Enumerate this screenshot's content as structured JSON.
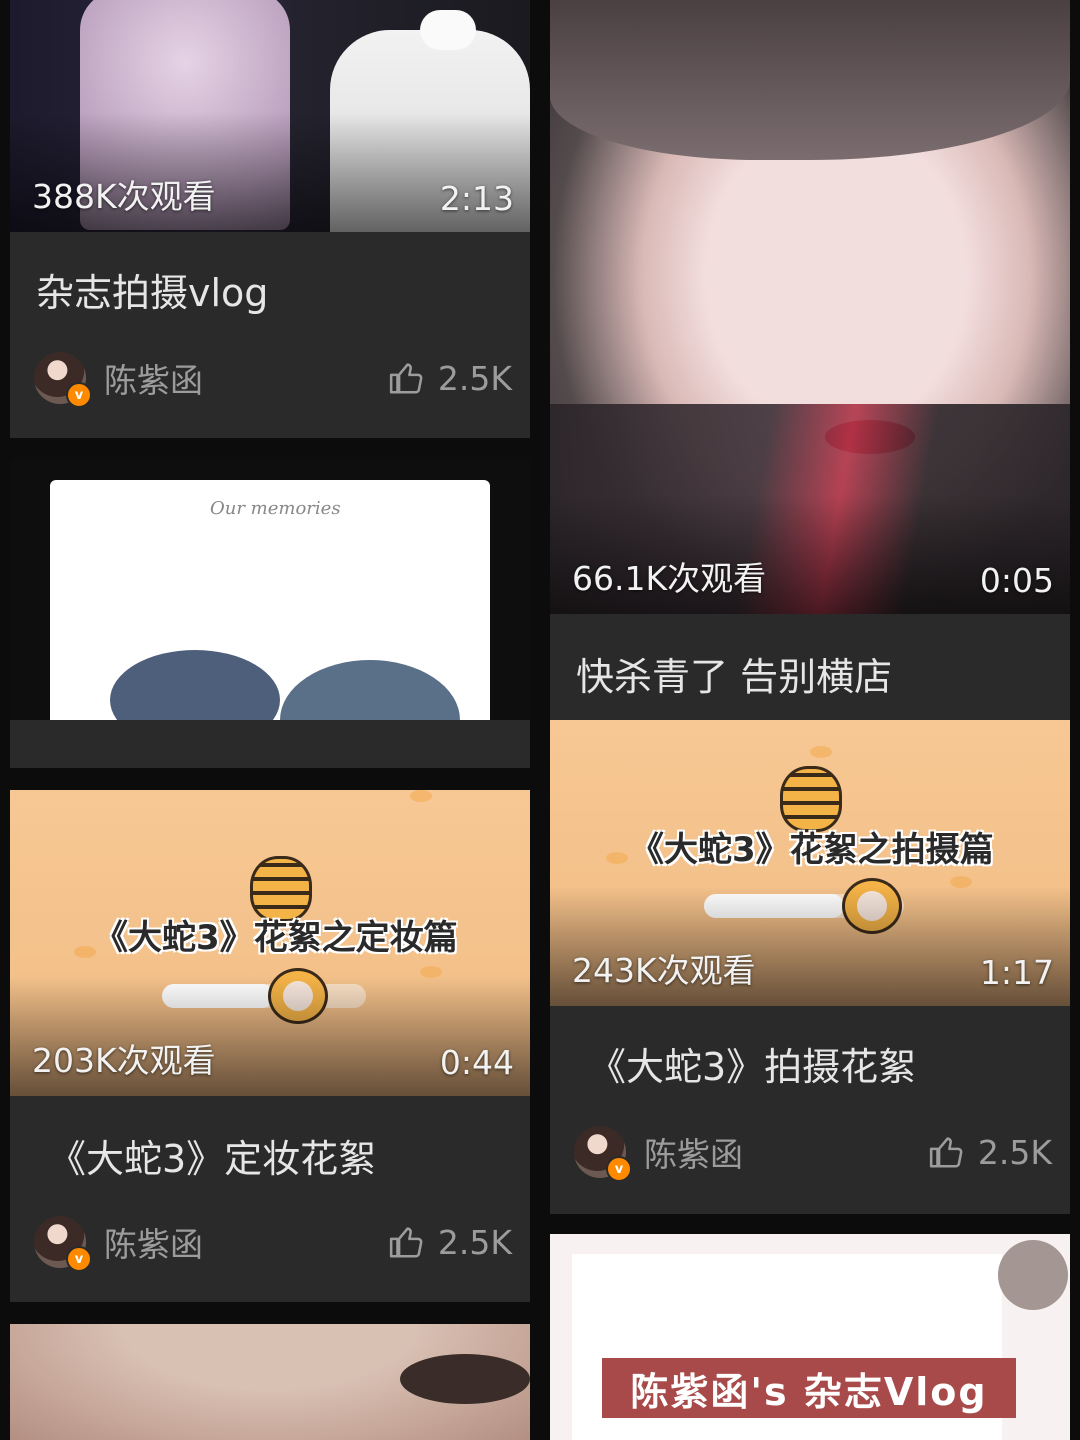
{
  "cards": [
    {
      "id": "c1",
      "views": "388K次观看",
      "duration": "2:13",
      "title": "杂志拍摄vlog",
      "author": "陈紫函",
      "likes": "2.5K"
    },
    {
      "id": "c2",
      "views": "",
      "duration": "",
      "title": "",
      "author": "",
      "likes": "",
      "thumb_text": "Our memories"
    },
    {
      "id": "c3",
      "views": "203K次观看",
      "duration": "0:44",
      "title": "《大蛇3》定妆花絮",
      "author": "陈紫函",
      "likes": "2.5K",
      "thumb_text": "《大蛇3》花絮之定妆篇"
    },
    {
      "id": "c5",
      "views": "66.1K次观看",
      "duration": "0:05",
      "title": "快杀青了 告别横店"
    },
    {
      "id": "c6",
      "views": "243K次观看",
      "duration": "1:17",
      "title": "《大蛇3》拍摄花絮",
      "author": "陈紫函",
      "likes": "2.5K",
      "thumb_text": "《大蛇3》花絮之拍摄篇"
    },
    {
      "id": "c7",
      "thumb_text": "陈紫函's 杂志Vlog"
    }
  ],
  "icons": {
    "like": "thumbs-up-icon",
    "verified": "verified-badge-icon"
  },
  "colors": {
    "background": "#0c0c0c",
    "card": "#2a2a2a",
    "badge": "#ff8a00"
  }
}
